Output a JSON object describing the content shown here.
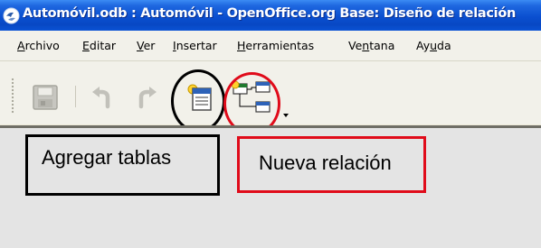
{
  "window": {
    "title": "Automóvil.odb : Automóvil - OpenOffice.org Base: Diseño de relación"
  },
  "menubar": {
    "items": [
      {
        "mnemonic": "A",
        "rest": "rchivo"
      },
      {
        "mnemonic": "E",
        "rest": "ditar"
      },
      {
        "mnemonic": "V",
        "rest": "er"
      },
      {
        "mnemonic": "I",
        "rest": "nsertar"
      },
      {
        "mnemonic": "H",
        "rest": "erramientas"
      },
      {
        "pre": "Ve",
        "mnemonic": "n",
        "rest": "tana"
      },
      {
        "pre": "Ay",
        "mnemonic": "u",
        "rest": "da"
      }
    ]
  },
  "toolbar": {
    "buttons": [
      {
        "icon": "save-icon",
        "enabled": false
      },
      {
        "icon": "undo-icon",
        "enabled": false
      },
      {
        "icon": "redo-icon",
        "enabled": false
      },
      {
        "icon": "add-tables-icon",
        "enabled": true
      },
      {
        "icon": "new-relation-icon",
        "enabled": true
      },
      {
        "icon": "toolbar-overflow-icon",
        "enabled": true
      }
    ]
  },
  "annotations": {
    "add_tables": "Agregar tablas",
    "new_relation": "Nueva relación",
    "colors": {
      "add_tables": "#000000",
      "new_relation": "#e00b1a"
    }
  }
}
